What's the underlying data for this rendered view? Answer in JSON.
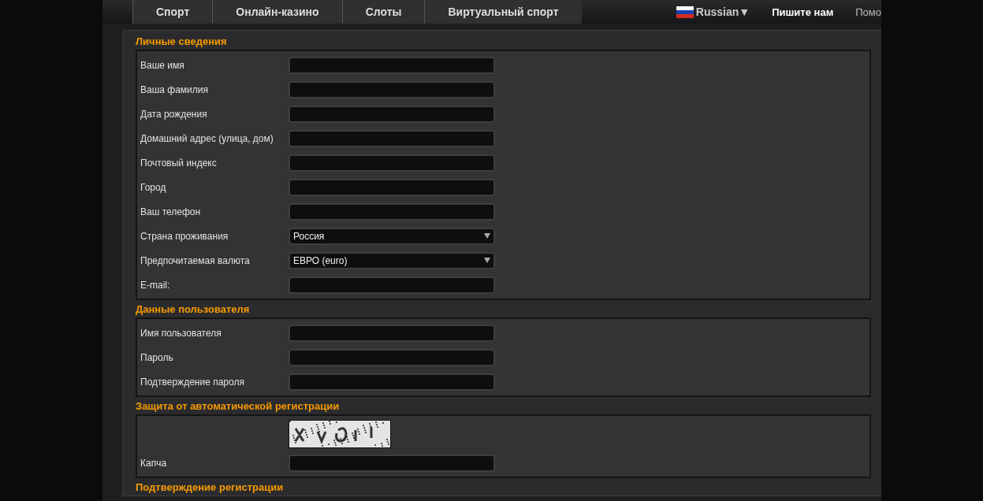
{
  "nav": {
    "tabs": [
      {
        "label": "Спорт"
      },
      {
        "label": "Онлайн-казино"
      },
      {
        "label": "Слоты"
      },
      {
        "label": "Виртуальный спорт"
      }
    ],
    "language": "Russian▼",
    "contact": "Пишите нам",
    "help": "Помо"
  },
  "sections": [
    {
      "title": "Личные сведения",
      "fields": [
        {
          "kind": "text",
          "label": "Ваше имя"
        },
        {
          "kind": "text",
          "label": "Ваша фамилия"
        },
        {
          "kind": "text",
          "label": "Дата рождения"
        },
        {
          "kind": "text",
          "label": "Домашний адрес (улица, дом)"
        },
        {
          "kind": "text",
          "label": "Почтовый индекс"
        },
        {
          "kind": "text",
          "label": "Город"
        },
        {
          "kind": "text",
          "label": "Ваш телефон"
        },
        {
          "kind": "select",
          "label": "Страна проживания",
          "value": "Россия"
        },
        {
          "kind": "select",
          "label": "Предпочитаемая валюта",
          "value": "EВРО (euro)"
        },
        {
          "kind": "text",
          "label": "E-mail:"
        }
      ]
    },
    {
      "title": "Данные пользователя",
      "fields": [
        {
          "kind": "text",
          "label": "Имя пользователя"
        },
        {
          "kind": "text",
          "label": "Пароль"
        },
        {
          "kind": "text",
          "label": "Подтверждение пароля"
        }
      ]
    },
    {
      "title": "Защита от автоматической регистрации",
      "fields": [
        {
          "kind": "captcha"
        },
        {
          "kind": "text",
          "label": "Капча"
        }
      ]
    },
    {
      "title": "Подтверждение регистрации"
    }
  ]
}
